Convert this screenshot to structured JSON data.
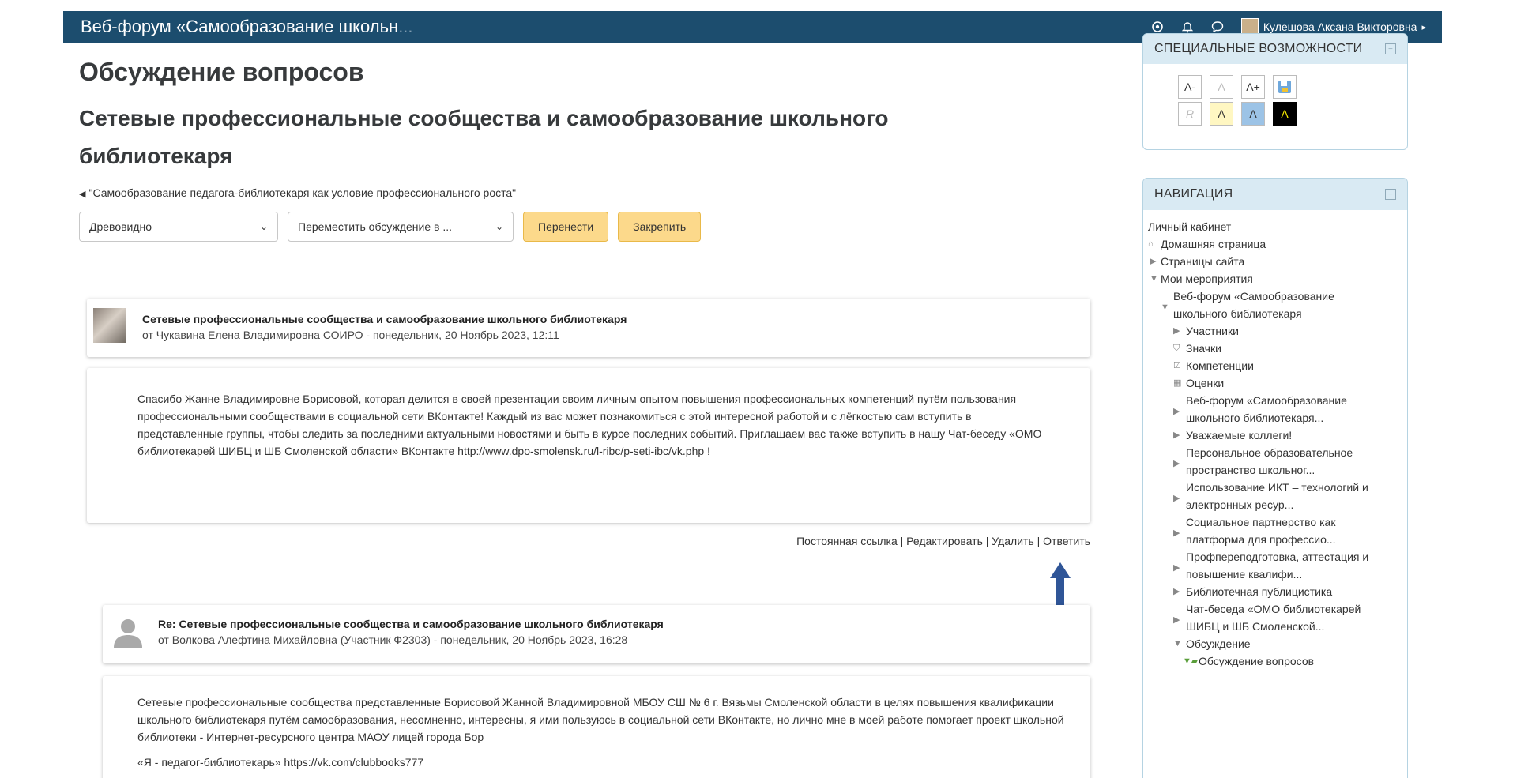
{
  "navbar": {
    "title": "Веб-форум «Самообразование школьн",
    "title_fade": "...",
    "user_name": "Кулешова Аксана Викторовна"
  },
  "main": {
    "page_title": "Обсуждение вопросов",
    "topic_title": "Сетевые профессиональные сообщества и самообразование школьного библиотекаря",
    "prev_link": "\"Самообразование педагога-библиотекаря как условие профессионального роста\"",
    "display_mode": "Древовидно",
    "move_select": "Переместить обсуждение в ...",
    "move_button": "Перенести",
    "pin_button": "Закрепить"
  },
  "posts": [
    {
      "title": "Сетевые профессиональные сообщества и самообразование школьного библиотекаря",
      "meta": "от Чукавина Елена Владимировна СОИРО - понедельник, 20 Ноябрь 2023, 12:11",
      "body": "Спасибо Жанне Владимировне Борисовой, которая делится в своей презентации своим личным опытом повышения профессиональных компетенций путём пользования профессиональными сообществами в социальной сети ВКонтакте! Каждый из вас может познакомиться с этой интересной работой и с лёгкостью сам вступить в представленные группы, чтобы следить за последними актуальными новостями и быть в курсе последних событий. Приглашаем вас также вступить в нашу Чат-беседу «ОМО библиотекарей ШИБЦ и ШБ Смоленской области» ВКонтакте http://www.dpo-smolensk.ru/l-ribc/p-seti-ibc/vk.php !",
      "actions": "Постоянная ссылка | Редактировать | Удалить | Ответить"
    },
    {
      "title": "Re: Сетевые профессиональные сообщества и самообразование школьного библиотекаря",
      "meta": "от Волкова Алефтина Михайловна (Участник Ф2303) - понедельник, 20 Ноябрь 2023, 16:28",
      "body": "Сетевые профессиональные сообщества представленные Борисовой Жанной Владимировной МБОУ СШ № 6 г. Вязьмы Смоленской области в целях повышения квалификации школьного библиотекаря путём самообразования, несомненно, интересны, я ими пользуюсь в социальной сети ВКонтакте, но лично мне в моей работе помогает проект школьной библиотеки - Интернет-ресурсного центра МАОУ лицей города Бор",
      "body2": "«Я - педагог-библиотекарь» https://vk.com/clubbooks777"
    }
  ],
  "accessibility": {
    "header": "СПЕЦИАЛЬНЫЕ ВОЗМОЖНОСТИ",
    "row1": [
      "A-",
      "A",
      "A+",
      ""
    ],
    "row2": [
      "R",
      "A",
      "A",
      "A"
    ]
  },
  "navigation": {
    "header": "НАВИГАЦИЯ",
    "items": [
      "Личный кабинет",
      "Домашняя страница",
      "Страницы сайта",
      "Мои мероприятия",
      "Веб-форум «Самообразование",
      "школьного библиотекаря",
      "Участники",
      "Значки",
      "Компетенции",
      "Оценки",
      "Веб-форум «Самообразование",
      "школьного библиотекаря...",
      "Уважаемые коллеги!",
      "Персональное образовательное",
      "пространство школьног...",
      "Использование ИКТ – технологий и",
      "электронных ресур...",
      "Социальное партнерство как",
      "платформа для профессио...",
      "Профпереподготовка, аттестация и",
      "повышение квалифи...",
      "Библиотечная публицистика",
      "Чат-беседа «ОМО библиотекарей",
      "ШИБЦ и ШБ Смоленской...",
      "Обсуждение",
      "Обсуждение вопросов"
    ]
  },
  "colors": {
    "navbar": "#1c4d6e",
    "button": "#fcd98b",
    "block_header": "#d9eaf3",
    "arrow": "#2f5597"
  }
}
